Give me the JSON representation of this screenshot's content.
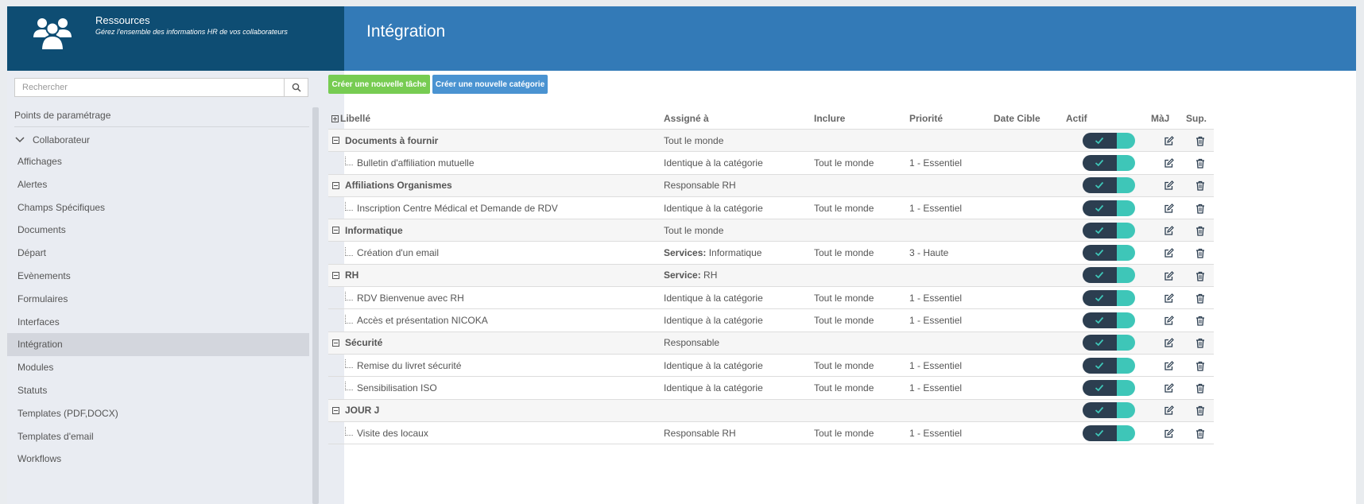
{
  "header": {
    "app_title": "Ressources",
    "app_subtitle": "Gérez l'ensemble des informations HR de vos collaborateurs",
    "page_title": "Intégration"
  },
  "sidebar": {
    "search_placeholder": "Rechercher",
    "section_label": "Points de paramétrage",
    "group_label": "Collaborateur",
    "items": [
      "Affichages",
      "Alertes",
      "Champs Spécifiques",
      "Documents",
      "Départ",
      "Evènements",
      "Formulaires",
      "Interfaces",
      "Intégration",
      "Modules",
      "Statuts",
      "Templates (PDF,DOCX)",
      "Templates d'email",
      "Workflows"
    ],
    "active_item": "Intégration"
  },
  "toolbar": {
    "new_task_label": "Créer une nouvelle tâche",
    "new_category_label": "Créer une nouvelle catégorie"
  },
  "table": {
    "columns": {
      "libelle": "Libellé",
      "assigne": "Assigné à",
      "inclure": "Inclure",
      "priorite": "Priorité",
      "date_cible": "Date Cible",
      "actif": "Actif",
      "maj": "MàJ",
      "sup": "Sup."
    },
    "rows": [
      {
        "type": "category",
        "label": "Documents à fournir",
        "assigned": "Tout le monde",
        "assigned_prefix": "",
        "include": "",
        "priority": "",
        "date": "",
        "active": true
      },
      {
        "type": "task",
        "label": "Bulletin d'affiliation mutuelle",
        "assigned": "Identique à la catégorie",
        "assigned_prefix": "",
        "include": "Tout le monde",
        "priority": "1 - Essentiel",
        "date": "",
        "active": true
      },
      {
        "type": "category",
        "label": "Affiliations Organismes",
        "assigned": "Responsable RH",
        "assigned_prefix": "",
        "include": "",
        "priority": "",
        "date": "",
        "active": true
      },
      {
        "type": "task",
        "label": "Inscription Centre Médical et Demande de RDV",
        "assigned": "Identique à la catégorie",
        "assigned_prefix": "",
        "include": "Tout le monde",
        "priority": "1 - Essentiel",
        "date": "",
        "active": true
      },
      {
        "type": "category",
        "label": "Informatique",
        "assigned": "Tout le monde",
        "assigned_prefix": "",
        "include": "",
        "priority": "",
        "date": "",
        "active": true
      },
      {
        "type": "task",
        "label": "Création d'un email",
        "assigned": "Informatique",
        "assigned_prefix": "Services: ",
        "include": "Tout le monde",
        "priority": "3 - Haute",
        "date": "",
        "active": true
      },
      {
        "type": "category",
        "label": "RH",
        "assigned": "RH",
        "assigned_prefix": "Service: ",
        "include": "",
        "priority": "",
        "date": "",
        "active": true
      },
      {
        "type": "task",
        "label": "RDV Bienvenue avec RH",
        "assigned": "Identique à la catégorie",
        "assigned_prefix": "",
        "include": "Tout le monde",
        "priority": "1 - Essentiel",
        "date": "",
        "active": true
      },
      {
        "type": "task",
        "label": "Accès et présentation NICOKA",
        "assigned": "Identique à la catégorie",
        "assigned_prefix": "",
        "include": "Tout le monde",
        "priority": "1 - Essentiel",
        "date": "",
        "active": true
      },
      {
        "type": "category",
        "label": "Sécurité",
        "assigned": "Responsable",
        "assigned_prefix": "",
        "include": "",
        "priority": "",
        "date": "",
        "active": true
      },
      {
        "type": "task",
        "label": "Remise du livret sécurité",
        "assigned": "Identique à la catégorie",
        "assigned_prefix": "",
        "include": "Tout le monde",
        "priority": "1 - Essentiel",
        "date": "",
        "active": true
      },
      {
        "type": "task",
        "label": "Sensibilisation ISO",
        "assigned": "Identique à la catégorie",
        "assigned_prefix": "",
        "include": "Tout le monde",
        "priority": "1 - Essentiel",
        "date": "",
        "active": true
      },
      {
        "type": "category",
        "label": "JOUR J",
        "assigned": "",
        "assigned_prefix": "",
        "include": "",
        "priority": "",
        "date": "",
        "active": true
      },
      {
        "type": "task",
        "label": "Visite des locaux",
        "assigned": "Responsable RH",
        "assigned_prefix": "",
        "include": "Tout le monde",
        "priority": "1 - Essentiel",
        "date": "",
        "active": true
      }
    ]
  },
  "icons": {
    "header": "users-icon",
    "search": "search-icon",
    "group": "chevron-down-icon",
    "expand": "plus-square-icon",
    "collapse": "minus-square-icon",
    "toggle": "check-icon",
    "edit": "edit-icon",
    "delete": "trash-icon"
  },
  "colors": {
    "sidebar_header": "#0e4d73",
    "main_header": "#337ab7",
    "green_button": "#77cc52",
    "blue_button": "#4a93d1",
    "toggle_dark": "#2c3e50",
    "toggle_accent": "#3ec6b8"
  }
}
